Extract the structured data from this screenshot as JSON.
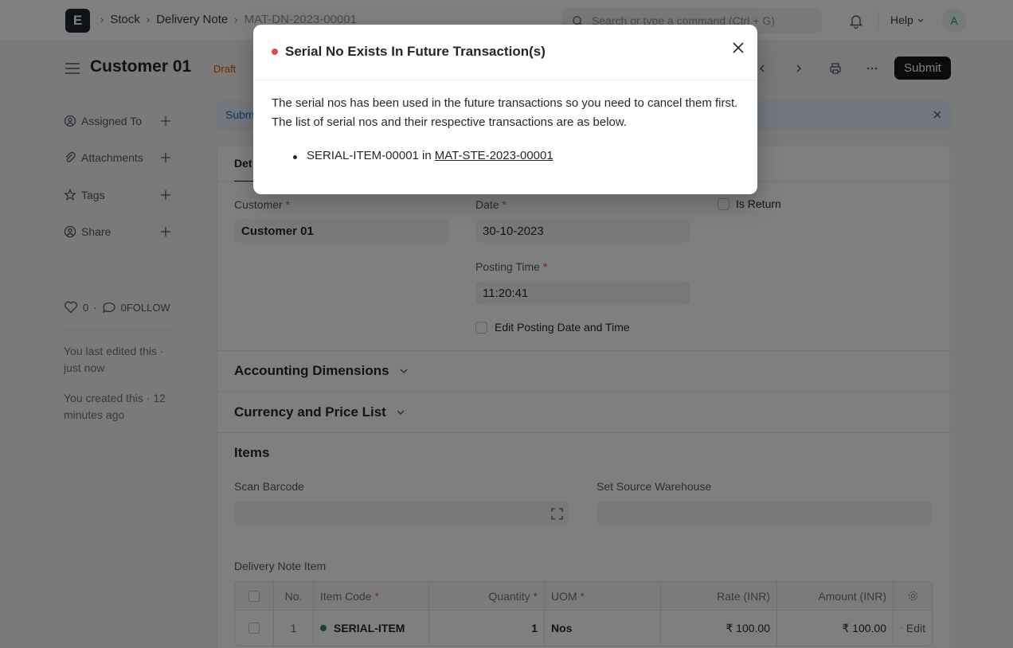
{
  "navbar": {
    "logo_letter": "E",
    "breadcrumbs": [
      "Stock",
      "Delivery Note",
      "MAT-DN-2023-00001"
    ],
    "search_placeholder": "Search or type a command (Ctrl + G)",
    "help_label": "Help",
    "avatar_letter": "A"
  },
  "page": {
    "title": "Customer 01",
    "status": "Draft",
    "submit_label": "Submit"
  },
  "sidebar": {
    "items": [
      {
        "label": "Assigned To",
        "icon": "assign-icon"
      },
      {
        "label": "Attachments",
        "icon": "paperclip-icon"
      },
      {
        "label": "Tags",
        "icon": "tag-icon"
      },
      {
        "label": "Share",
        "icon": "share-icon"
      }
    ],
    "likes": "0",
    "comments": "0",
    "follow_label": "FOLLOW",
    "last_edited": "You last edited this · just now",
    "created": "You created this · 12 minutes ago"
  },
  "alert": {
    "text": "Subm"
  },
  "tabs": {
    "active": "Det"
  },
  "form": {
    "customer_label": "Customer",
    "customer_value": "Customer 01",
    "date_label": "Date",
    "date_value": "30-10-2023",
    "is_return_label": "Is Return",
    "posting_time_label": "Posting Time",
    "posting_time_value": "11:20:41",
    "edit_posting_label": "Edit Posting Date and Time",
    "sections": {
      "accounting": "Accounting Dimensions",
      "currency": "Currency and Price List",
      "items": "Items"
    },
    "scan_barcode_label": "Scan Barcode",
    "source_warehouse_label": "Set Source Warehouse",
    "table_label": "Delivery Note Item"
  },
  "grid": {
    "columns": [
      "No.",
      "Item Code",
      "Quantity",
      "UOM",
      "Rate (INR)",
      "Amount (INR)"
    ],
    "rows": [
      {
        "no": "1",
        "item_code": "SERIAL-ITEM",
        "qty": "1",
        "uom": "Nos",
        "rate": "₹ 100.00",
        "amount": "₹ 100.00",
        "edit": "Edit"
      }
    ]
  },
  "modal": {
    "title": "Serial No Exists In Future Transaction(s)",
    "body": "The serial nos has been used in the future transactions so you need to cancel them first. The list of serial nos and their respective transactions are as below.",
    "entries": [
      {
        "serial": "SERIAL-ITEM-00001 in",
        "transaction": "MAT-STE-2023-00001"
      }
    ]
  },
  "colors": {
    "status_draft": "#c9582a",
    "primary_button": "#171717",
    "indicator_red": "#e24c4c",
    "indicator_green": "#2b8a5f"
  }
}
